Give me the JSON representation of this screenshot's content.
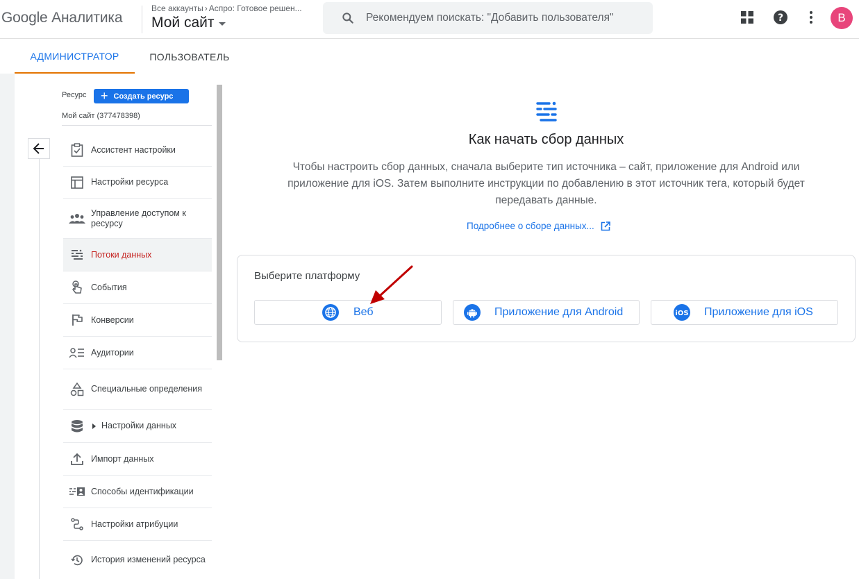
{
  "header": {
    "brand": "Google Аналитика",
    "breadcrumb_root": "Все аккаунты",
    "breadcrumb_account": "Аспро: Готовое решен...",
    "property_name": "Мой сайт",
    "search_placeholder": "Рекомендуем поискать: \"Добавить пользователя\"",
    "avatar_letter": "В",
    "avatar_color": "#e8457b"
  },
  "tabs": [
    {
      "label": "АДМИНИСТРАТОР",
      "active": true
    },
    {
      "label": "ПОЛЬЗОВАТЕЛЬ",
      "active": false
    }
  ],
  "sidebar": {
    "resource_label": "Ресурс",
    "create_button": "Создать ресурс",
    "resource_name": "Мой сайт (377478398)",
    "items": [
      {
        "label": "Ассистент настройки",
        "icon": "checklist-icon"
      },
      {
        "label": "Настройки ресурса",
        "icon": "layout-icon"
      },
      {
        "label": "Управление доступом к ресурсу",
        "icon": "people-icon"
      },
      {
        "label": "Потоки данных",
        "icon": "data-streams-icon",
        "active": true
      },
      {
        "label": "События",
        "icon": "touch-icon"
      },
      {
        "label": "Конверсии",
        "icon": "flag-icon"
      },
      {
        "label": "Аудитории",
        "icon": "audience-icon"
      },
      {
        "label": "Специальные определения",
        "icon": "shapes-icon"
      },
      {
        "label": "Настройки данных",
        "icon": "database-icon",
        "expandable": true
      },
      {
        "label": "Импорт данных",
        "icon": "upload-icon"
      },
      {
        "label": "Способы идентификации",
        "icon": "id-card-icon"
      },
      {
        "label": "Настройки атрибуции",
        "icon": "attribution-icon"
      },
      {
        "label": "История изменений ресурса",
        "icon": "history-icon"
      }
    ]
  },
  "main": {
    "title": "Как начать сбор данных",
    "description": "Чтобы настроить сбор данных, сначала выберите тип источника – сайт, приложение для Android или приложение для iOS. Затем выполните инструкции по добавлению в этот источник тега, который будет передавать данные.",
    "learn_more": "Подробнее о сборе данных...",
    "platform_label": "Выберите платформу",
    "platforms": [
      {
        "label": "Веб",
        "icon": "globe-icon"
      },
      {
        "label": "Приложение для Android",
        "icon": "android-icon"
      },
      {
        "label": "Приложение для iOS",
        "icon": "ios-icon"
      }
    ]
  },
  "colors": {
    "accent": "#1a73e8",
    "tab_indicator": "#e37400",
    "active_nav_text": "#c5221f",
    "annotation_arrow": "#c00000"
  }
}
